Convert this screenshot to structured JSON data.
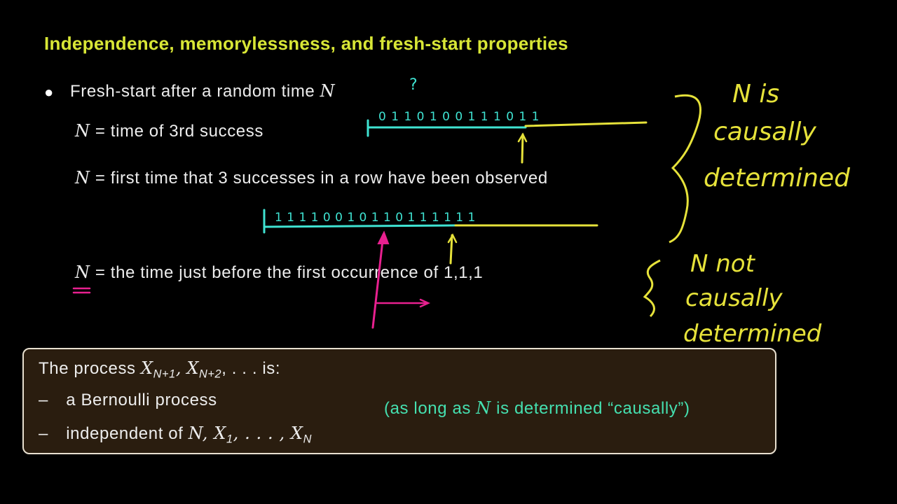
{
  "slide": {
    "title": "Independence, memorylessness, and fresh-start properties",
    "bullet": {
      "text": "Fresh-start after a random time",
      "var": "N",
      "annotation": "?"
    },
    "defs": [
      {
        "var": "N",
        "eq": "=",
        "text": "time of 3rd success"
      },
      {
        "var": "N",
        "eq": "=",
        "text": "first time that 3 successes in a row have been observed"
      },
      {
        "var": "N",
        "eq": "=",
        "text": "the time just before the first occurrence of 1,1,1"
      }
    ],
    "sequences": {
      "top": "0 1 1 0 1 0 0 1 1 1 0 1 1",
      "middle": "1 1 1 1 0 0 1 0 1 1 0 1 1 1 1 1 1"
    },
    "handwriting": {
      "causal": [
        "N is",
        "causally",
        "determined"
      ],
      "not_causal": [
        "N not",
        "causally",
        "determined"
      ]
    },
    "box": {
      "line1_prefix": "The process",
      "line1_math": "X",
      "sub1": "N+1",
      "sub2": "N+2",
      "line1_suffix": ", . . . is:",
      "dash": "–",
      "item1": "a Bernoulli process",
      "item2_prefix": "independent of",
      "item2_math": "N, X",
      "item2_sub1": "1",
      "item2_mid": ", . . . , X",
      "item2_subN": "N",
      "note_prefix": "(as long as",
      "note_var": "N",
      "note_suffix": "is determined “causally”)"
    }
  },
  "colors": {
    "title": "#d8e636",
    "cyan": "#3fe3d2",
    "yellow": "#e6e23a",
    "magenta": "#e8208f",
    "box_bg": "#2a1d0f",
    "note": "#45e0b0"
  }
}
